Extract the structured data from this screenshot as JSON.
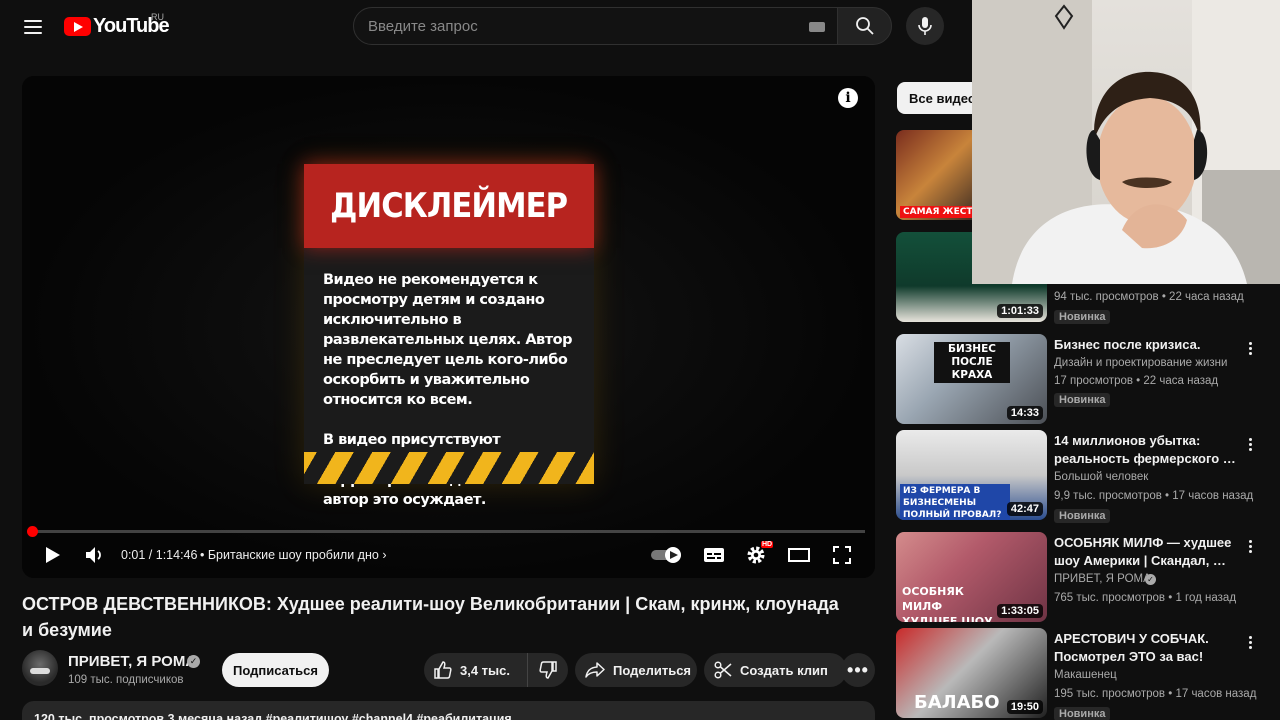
{
  "header": {
    "logo_text": "YouTube",
    "country_code": "RU",
    "search_placeholder": "Введите запрос"
  },
  "player": {
    "current_time": "0:01",
    "duration": "1:14:46",
    "time_display": "0:01 / 1:14:46",
    "chapter": "• Британские шоу пробили дно",
    "progress": 0.0002,
    "hd_badge": "HD",
    "disclaimer": {
      "heading": "ДИСКЛЕЙМЕР",
      "paragraph_1": "Видео не рекомендуется к просмотру детям и создано исключительно в развлекательных целях. Автор не преследует цель кого-либо оскорбить и уважительно относится ко всем.",
      "paragraph_2": "В видео присутствуют упоминания запрещенных на территории РФ движений и автор это осуждает."
    }
  },
  "video": {
    "title": "ОСТРОВ ДЕВСТВЕННИКОВ: Худшее реалити-шоу Великобритании | Скам, кринж, клоунада и безумие",
    "channel_name": "ПРИВЕТ, Я РОМА",
    "subscribers": "109 тыс. подписчиков",
    "subscribe_label": "Подписаться",
    "likes": "3,4 тыс.",
    "share_label": "Поделиться",
    "clip_label": "Создать клип",
    "description_preview": "120 тыс. просмотров  3 месяца назад  #реалитишоу #channel4 #реабилитация"
  },
  "sidebar": {
    "chip_label": "Все видео",
    "recommendations": [
      {
        "title": "",
        "channel": "",
        "meta": "",
        "badge": "",
        "duration": "",
        "caption": "САМАЯ ЖЕСТКАЯ"
      },
      {
        "title": "",
        "channel": "",
        "meta": "94 тыс. просмотров • 22 часа назад",
        "badge": "Новинка",
        "duration": "1:01:33",
        "caption": ""
      },
      {
        "title": "Бизнес после кризиса.",
        "channel": "Дизайн и проектирование жизни",
        "meta": "17 просмотров • 22 часа назад",
        "badge": "Новинка",
        "duration": "14:33",
        "caption": "БИЗНЕС ПОСЛЕ КРАХА"
      },
      {
        "title": "14 миллионов убытка: реальность фермерского …",
        "channel": "Большой человек",
        "meta": "9,9 тыс. просмотров • 17 часов назад",
        "badge": "Новинка",
        "duration": "42:47",
        "caption": "ИЗ ФЕРМЕРА В БИЗНЕСМЕНЫ ПОЛНЫЙ ПРОВАЛ?"
      },
      {
        "title": "ОСОБНЯК МИЛФ — худшее шоу Америки | Скандал, …",
        "channel": "ПРИВЕТ, Я РОМА",
        "meta": "765 тыс. просмотров • 1 год назад",
        "badge": "",
        "duration": "1:33:05",
        "caption": "ОСОБНЯК МИЛФ ХУДШЕЕ ШОУ АМ"
      },
      {
        "title": "АРЕСТОВИЧ У СОБЧАК. Посмотрел ЭТО за вас!",
        "channel": "Макашенец",
        "meta": "195 тыс. просмотров • 17 часов назад",
        "badge": "Новинка",
        "duration": "19:50",
        "caption": "БАЛАБО"
      }
    ]
  },
  "colors": {
    "background": "#0f0f0f",
    "accent_red": "#ff0000",
    "disclaimer_red": "#b7241f",
    "hazard_yellow": "#f1b51c"
  }
}
